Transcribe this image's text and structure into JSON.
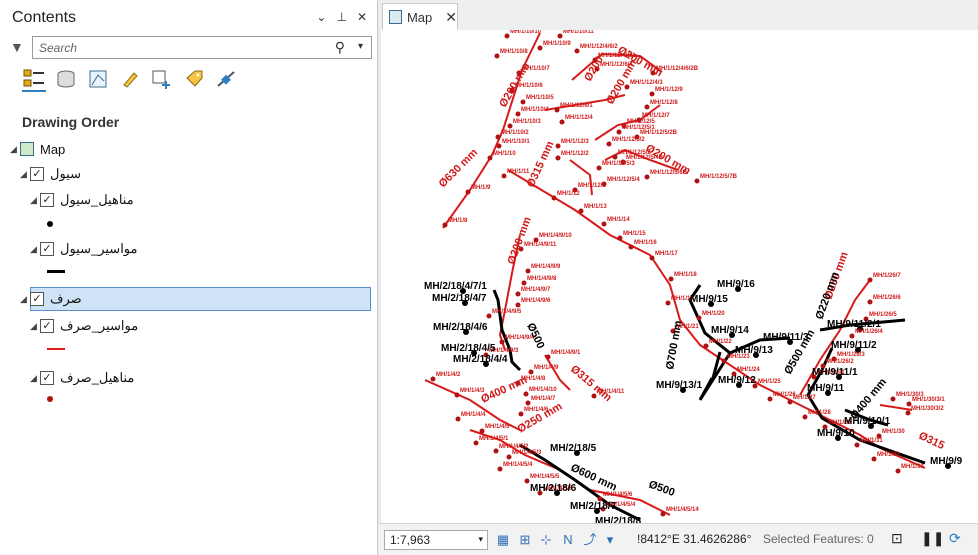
{
  "contents": {
    "title": "Contents",
    "search_placeholder": "Search",
    "section": "Drawing Order",
    "tree": {
      "map": "Map",
      "group1": "سيول",
      "layer1": "مناهيل_سيول",
      "layer2": "مواسير_سيول",
      "group2": "صرف",
      "layer3": "مواسير_صرف",
      "layer4": "مناهيل_صرف"
    },
    "check": "✓"
  },
  "tab": {
    "title": "Map",
    "close": "✕"
  },
  "status": {
    "scale": "1:7,963",
    "coords": "!8412°E 31.4626286°",
    "selected": "Selected Features: 0"
  },
  "map": {
    "red_labels": [
      [
        "MH/1/10/10",
        510,
        33
      ],
      [
        "MH/1/10/11",
        563,
        33
      ],
      [
        "MH/1/10/9",
        543,
        45
      ],
      [
        "MH/1/12/4/6/2",
        580,
        48
      ],
      [
        "MH/1/10/8",
        500,
        53
      ],
      [
        "MH/1/12/4/6/1",
        598,
        57
      ],
      [
        "MH/1/12/6/4",
        600,
        66
      ],
      [
        "MH/1/10/7",
        522,
        70
      ],
      [
        "MH/1/12/4/6/2B",
        656,
        70
      ],
      [
        "MH/1/12/4/3",
        630,
        84
      ],
      [
        "MH/1/10/6",
        515,
        87
      ],
      [
        "MH/1/12/9",
        655,
        91
      ],
      [
        "MH/1/10/5",
        526,
        99
      ],
      [
        "MH/1/12/8",
        650,
        104
      ],
      [
        "MH/1/10/4",
        521,
        111
      ],
      [
        "MH/1/12/6/1",
        560,
        107
      ],
      [
        "MH/1/12/7",
        642,
        117
      ],
      [
        "MH/1/10/3",
        513,
        123
      ],
      [
        "MH/1/12/4",
        565,
        119
      ],
      [
        "MH/1/12/5",
        627,
        123
      ],
      [
        "MH/1/10/2",
        501,
        134
      ],
      [
        "MH/1/12/5/1",
        622,
        129
      ],
      [
        "MH/1/12/5/2B",
        640,
        134
      ],
      [
        "MH/1/10/1",
        502,
        143
      ],
      [
        "MH/1/12/3",
        561,
        143
      ],
      [
        "MH/1/12/5/2",
        612,
        141
      ],
      [
        "MH/1/10",
        493,
        155
      ],
      [
        "MH/1/12/2",
        561,
        155
      ],
      [
        "MH/1/12/5/2",
        618,
        154
      ],
      [
        "MH/1/12/5/4B",
        626,
        159
      ],
      [
        "MH/1/12/5/3",
        602,
        165
      ],
      [
        "MH/1/12/5/6B",
        650,
        174
      ],
      [
        "MH/1/12/5/7B",
        700,
        178
      ],
      [
        "MH/1/11",
        507,
        173
      ],
      [
        "MH/1/12/5/4",
        607,
        181
      ],
      [
        "MH/1/12/1",
        578,
        187
      ],
      [
        "MH/1/9",
        471,
        189
      ],
      [
        "MH/1/12",
        557,
        195
      ],
      [
        "MH/1/13",
        584,
        208
      ],
      [
        "MH/1/14",
        607,
        221
      ],
      [
        "MH/1/8",
        448,
        222
      ],
      [
        "MH/1/15",
        623,
        235
      ],
      [
        "MH/1/16",
        634,
        244
      ],
      [
        "MH/1/17",
        655,
        255
      ],
      [
        "MH/1/4/9/10",
        539,
        237
      ],
      [
        "MH/1/4/9/11",
        524,
        246
      ],
      [
        "MH/1/4/9/9",
        531,
        268
      ],
      [
        "MH/1/4/9/8",
        527,
        280
      ],
      [
        "MH/1/4/9/7",
        521,
        291
      ],
      [
        "MH/1/4/9/6",
        521,
        302
      ],
      [
        "MH/1/4/9/5",
        492,
        313
      ],
      [
        "MH/1/18",
        674,
        276
      ],
      [
        "MH/1/19",
        671,
        300
      ],
      [
        "MH/1/20",
        702,
        315
      ],
      [
        "MH/1/21",
        676,
        328
      ],
      [
        "MH/1/4/9/4",
        505,
        339
      ],
      [
        "MH/1/4/9/3",
        489,
        352
      ],
      [
        "MH/1/4/9/1",
        551,
        354
      ],
      [
        "MH/1/4/9",
        534,
        369
      ],
      [
        "MH/1/22",
        709,
        343
      ],
      [
        "MH/1/23",
        727,
        358
      ],
      [
        "MH/1/24",
        737,
        371
      ],
      [
        "MH/1/25",
        758,
        383
      ],
      [
        "MH/1/26",
        773,
        396
      ],
      [
        "MH/1/4/2",
        436,
        376
      ],
      [
        "MH/1/4/3",
        460,
        392
      ],
      [
        "MH/1/4/8",
        521,
        380
      ],
      [
        "MH/1/4/10",
        529,
        391
      ],
      [
        "MH/1/4/11",
        597,
        393
      ],
      [
        "MH/1/4/7",
        531,
        400
      ],
      [
        "MH/1/4/6",
        524,
        411
      ],
      [
        "MH/1/4/4",
        461,
        416
      ],
      [
        "MH/1/4/5",
        485,
        428
      ],
      [
        "MH/1/4/5/1",
        479,
        440
      ],
      [
        "MH/1/4/5/2",
        499,
        448
      ],
      [
        "MH/1/4/5/3",
        512,
        454
      ],
      [
        "MH/1/4/5/4",
        503,
        466
      ],
      [
        "MH/1/4/5/5",
        530,
        478
      ],
      [
        "MH/1/4/5/6",
        543,
        490
      ],
      [
        "MH/1/4/5/6",
        603,
        496
      ],
      [
        "MH/1/4/5/4",
        606,
        506
      ],
      [
        "MH/1/4/5/14",
        666,
        511
      ],
      [
        "MH/1/26/7",
        873,
        277
      ],
      [
        "MH/1/26/6",
        873,
        299
      ],
      [
        "MH/1/26/5",
        869,
        316
      ],
      [
        "MH/1/26/4",
        855,
        333
      ],
      [
        "MH/1/26/3",
        837,
        356
      ],
      [
        "MH/1/26/2",
        826,
        363
      ],
      [
        "MH/1/26/1",
        817,
        374
      ],
      [
        "MH/1/27",
        793,
        399
      ],
      [
        "MH/1/30/3",
        896,
        396
      ],
      [
        "MH/1/30/3/1",
        912,
        401
      ],
      [
        "MH/1/30/3/2",
        911,
        410
      ],
      [
        "MH/1/28",
        808,
        414
      ],
      [
        "MH/1/29",
        828,
        424
      ],
      [
        "MH/1/30",
        882,
        433
      ],
      [
        "MH/1/31",
        860,
        442
      ],
      [
        "MH/1/32",
        877,
        456
      ],
      [
        "MH/1/33",
        901,
        468
      ]
    ],
    "black_labels": [
      [
        "MH/9/16",
        717,
        287
      ],
      [
        "MH/2/18/4/7/1",
        424,
        289
      ],
      [
        "MH/2/18/4/7",
        432,
        301
      ],
      [
        "MH/9/15",
        690,
        302
      ],
      [
        "MH/2/18/4/6",
        433,
        330
      ],
      [
        "MH/9/14",
        711,
        333
      ],
      [
        "MH/9/11/2/1",
        827,
        327
      ],
      [
        "MH/9/11/3",
        763,
        340
      ],
      [
        "MH/2/18/4/5",
        441,
        351
      ],
      [
        "MH/9/13",
        735,
        353
      ],
      [
        "MH/9/11/2",
        831,
        348
      ],
      [
        "MH/2/18/4/4",
        453,
        362
      ],
      [
        "MH/9/11/1",
        812,
        375
      ],
      [
        "MH/9/12",
        718,
        383
      ],
      [
        "MH/9/13/1",
        656,
        388
      ],
      [
        "MH/9/11",
        807,
        391
      ],
      [
        "MH/9/10/1",
        844,
        424
      ],
      [
        "MH/9/10",
        817,
        436
      ],
      [
        "MH/2/18/5",
        550,
        451
      ],
      [
        "MH/9/9",
        930,
        464
      ],
      [
        "MH/2/18/6",
        530,
        491
      ],
      [
        "MH/2/18/7",
        570,
        509
      ],
      [
        "MH/2/18/8",
        595,
        524
      ]
    ],
    "pipe_labels": [
      [
        "Ø200 mm",
        617,
        52,
        30,
        "#d01818"
      ],
      [
        "Ø200",
        590,
        82,
        -60,
        "#d01818"
      ],
      [
        "Ø200 mm",
        505,
        108,
        -60,
        "#d01818"
      ],
      [
        "Ø200 mm",
        612,
        105,
        -60,
        "#d01818"
      ],
      [
        "Ø200 mm",
        645,
        150,
        30,
        "#d01818"
      ],
      [
        "Ø630 mm",
        443,
        188,
        -45,
        "#d01818"
      ],
      [
        "Ø315 mm",
        533,
        188,
        -65,
        "#d01818"
      ],
      [
        "Ø200 mm",
        514,
        265,
        -70,
        "#d01818"
      ],
      [
        "Ø250 mm",
        831,
        300,
        -70,
        "#d01818"
      ],
      [
        "Ø500",
        527,
        325,
        65,
        "#000"
      ],
      [
        "Ø315 mm",
        570,
        370,
        40,
        "#d01818"
      ],
      [
        "Ø400 mm",
        483,
        403,
        -25,
        "#d01818"
      ],
      [
        "Ø700 mm",
        673,
        370,
        -80,
        "#000"
      ],
      [
        "Ø500 mm",
        790,
        375,
        -60,
        "#000"
      ],
      [
        "Ø400 mm",
        855,
        420,
        -50,
        "#000"
      ],
      [
        "Ø315",
        918,
        438,
        25,
        "#d01818"
      ],
      [
        "Ø250 mm",
        520,
        433,
        -30,
        "#d01818"
      ],
      [
        "Ø600 mm",
        570,
        470,
        25,
        "#000"
      ],
      [
        "Ø500",
        648,
        487,
        20,
        "#000"
      ],
      [
        "Ø220 mm",
        822,
        320,
        -70,
        "#000"
      ]
    ]
  }
}
